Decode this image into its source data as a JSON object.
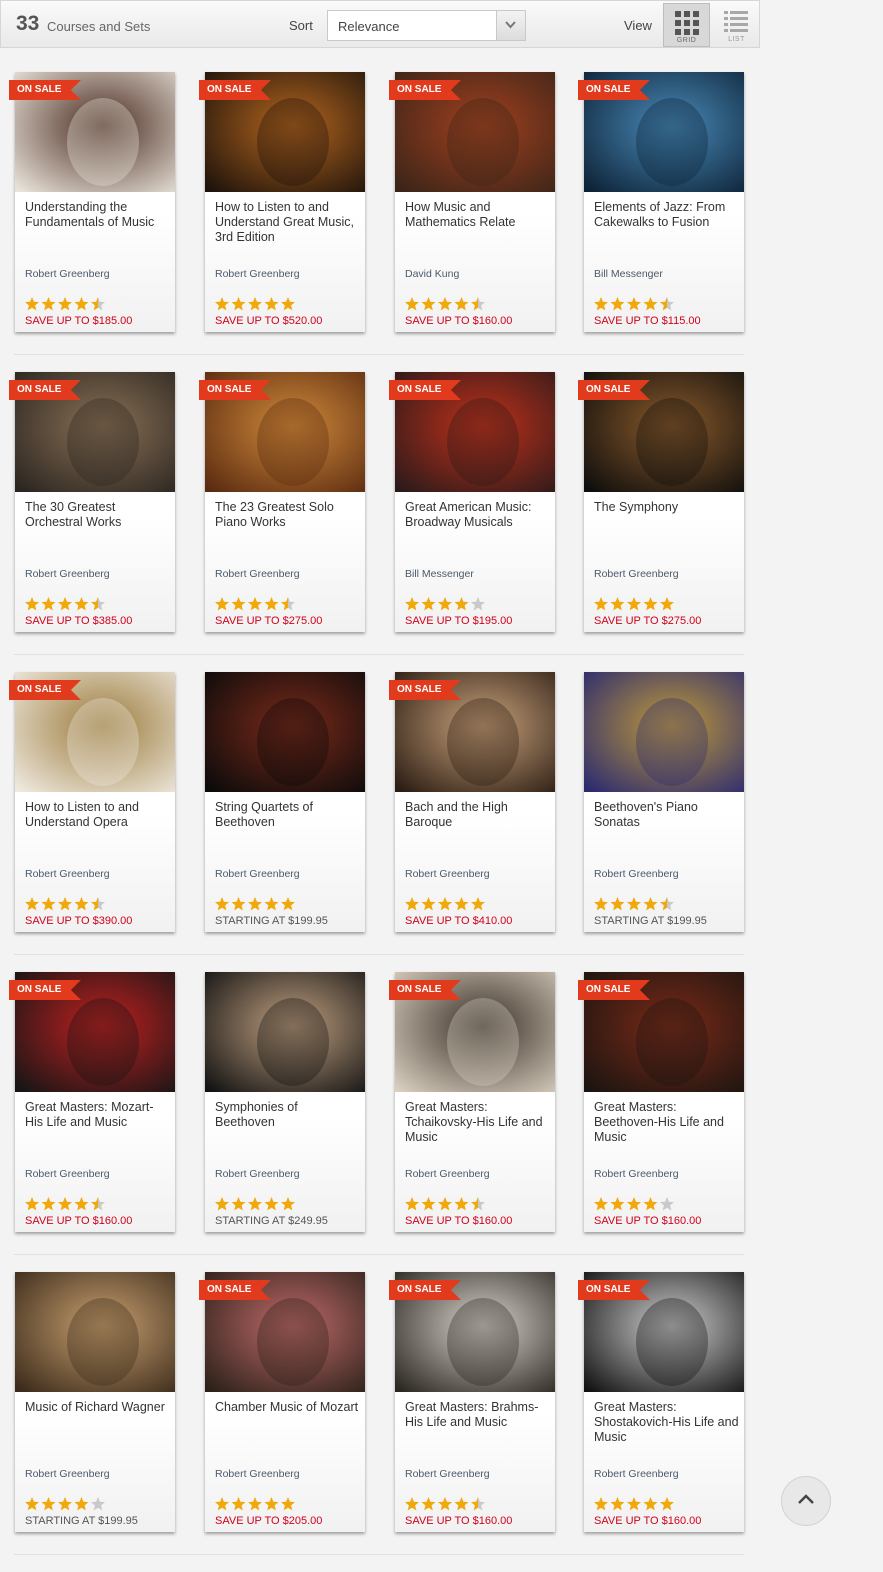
{
  "toolbar": {
    "count": "33",
    "count_label": "Courses and Sets",
    "sort_label": "Sort",
    "sort_value": "Relevance",
    "view_label": "View",
    "grid_label": "GRID",
    "list_label": "LIST",
    "grid_icon": "grid-icon",
    "list_icon": "list-icon"
  },
  "colors": {
    "sale": "#e23a1c",
    "price_sale": "#d0021b",
    "star": "#f0a80b"
  },
  "sale_badge_text": "ON SALE",
  "back_to_top_icon": "chevron-up-icon",
  "courses": [
    {
      "title": "Understanding the Fundamentals of Music",
      "author": "Robert Greenberg",
      "rating": 4.5,
      "price": "SAVE UP TO $185.00",
      "on_sale": true,
      "price_type": "sale",
      "tint": [
        "#e9e4da",
        "#4a2a20"
      ]
    },
    {
      "title": "How to Listen to and Understand Great Music, 3rd Edition",
      "author": "Robert Greenberg",
      "rating": 5,
      "price": "SAVE UP TO $520.00",
      "on_sale": true,
      "price_type": "sale",
      "tint": [
        "#1c120b",
        "#b5661e"
      ]
    },
    {
      "title": "How Music and Mathematics Relate",
      "author": "David Kung",
      "rating": 4.5,
      "price": "SAVE UP TO $160.00",
      "on_sale": true,
      "price_type": "sale",
      "tint": [
        "#3a2418",
        "#a1401f"
      ]
    },
    {
      "title": "Elements of Jazz: From Cakewalks to Fusion",
      "author": "Bill Messenger",
      "rating": 4.5,
      "price": "SAVE UP TO $115.00",
      "on_sale": true,
      "price_type": "sale",
      "tint": [
        "#0c2236",
        "#4a8ab8"
      ]
    },
    {
      "title": "The 30 Greatest Orchestral Works",
      "author": "Robert Greenberg",
      "rating": 4.5,
      "price": "SAVE UP TO $385.00",
      "on_sale": true,
      "price_type": "sale",
      "tint": [
        "#2a2520",
        "#8a7055"
      ]
    },
    {
      "title": "The 23 Greatest Solo Piano Works",
      "author": "Robert Greenberg",
      "rating": 4.5,
      "price": "SAVE UP TO $275.00",
      "on_sale": true,
      "price_type": "sale",
      "tint": [
        "#5a2a10",
        "#d08a3a"
      ]
    },
    {
      "title": "Great American Music: Broadway Musicals",
      "author": "Bill Messenger",
      "rating": 4,
      "price": "SAVE UP TO $195.00",
      "on_sale": true,
      "price_type": "sale",
      "tint": [
        "#2a1a1a",
        "#c0301a"
      ]
    },
    {
      "title": "The Symphony",
      "author": "Robert Greenberg",
      "rating": 5,
      "price": "SAVE UP TO $275.00",
      "on_sale": true,
      "price_type": "sale",
      "tint": [
        "#0d0d0d",
        "#8a5a2a"
      ]
    },
    {
      "title": "How to Listen to and Understand Opera",
      "author": "Robert Greenberg",
      "rating": 4.5,
      "price": "SAVE UP TO $390.00",
      "on_sale": true,
      "price_type": "sale",
      "tint": [
        "#efe9df",
        "#9a7a3a"
      ]
    },
    {
      "title": "String Quartets of Beethoven",
      "author": "Robert Greenberg",
      "rating": 5,
      "price": "STARTING AT $199.95",
      "on_sale": false,
      "price_type": "start",
      "tint": [
        "#0a0a0a",
        "#7a2a1a"
      ]
    },
    {
      "title": "Bach and the High Baroque",
      "author": "Robert Greenberg",
      "rating": 5,
      "price": "SAVE UP TO $410.00",
      "on_sale": true,
      "price_type": "sale",
      "tint": [
        "#2a1c12",
        "#c9a27c"
      ]
    },
    {
      "title": "Beethoven's Piano Sonatas",
      "author": "Robert Greenberg",
      "rating": 4.5,
      "price": "STARTING AT $199.95",
      "on_sale": false,
      "price_type": "start",
      "tint": [
        "#2a2a70",
        "#c09a3a"
      ]
    },
    {
      "title": "Great Masters: Mozart-His Life and Music",
      "author": "Robert Greenberg",
      "rating": 4.5,
      "price": "SAVE UP TO $160.00",
      "on_sale": true,
      "price_type": "sale",
      "tint": [
        "#151515",
        "#c02020"
      ]
    },
    {
      "title": "Symphonies of Beethoven",
      "author": "Robert Greenberg",
      "rating": 5,
      "price": "STARTING AT $249.95",
      "on_sale": false,
      "price_type": "start",
      "tint": [
        "#121212",
        "#c0a080"
      ]
    },
    {
      "title": "Great Masters: Tchaikovsky-His Life and Music",
      "author": "Robert Greenberg",
      "rating": 4.5,
      "price": "SAVE UP TO $160.00",
      "on_sale": true,
      "price_type": "sale",
      "tint": [
        "#d8cfbf",
        "#3a3028"
      ]
    },
    {
      "title": "Great Masters: Beethoven-His Life and Music",
      "author": "Robert Greenberg",
      "rating": 4,
      "price": "SAVE UP TO $160.00",
      "on_sale": true,
      "price_type": "sale",
      "tint": [
        "#1a1410",
        "#7a2a18"
      ]
    },
    {
      "title": "Music of Richard Wagner",
      "author": "Robert Greenberg",
      "rating": 4,
      "price": "STARTING AT $199.95",
      "on_sale": false,
      "price_type": "start",
      "tint": [
        "#3a2a1a",
        "#c9a070"
      ]
    },
    {
      "title": "Chamber Music of Mozart",
      "author": "Robert Greenberg",
      "rating": 5,
      "price": "SAVE UP TO $205.00",
      "on_sale": true,
      "price_type": "sale",
      "tint": [
        "#2a2018",
        "#c06a6a"
      ]
    },
    {
      "title": "Great Masters: Brahms-His Life and Music",
      "author": "Robert Greenberg",
      "rating": 4.5,
      "price": "SAVE UP TO $160.00",
      "on_sale": true,
      "price_type": "sale",
      "tint": [
        "#2a2620",
        "#d9d4cc"
      ]
    },
    {
      "title": "Great Masters: Shostakovich-His Life and Music",
      "author": "Robert Greenberg",
      "rating": 5,
      "price": "SAVE UP TO $160.00",
      "on_sale": true,
      "price_type": "sale",
      "tint": [
        "#111111",
        "#cfcfcf"
      ]
    }
  ]
}
